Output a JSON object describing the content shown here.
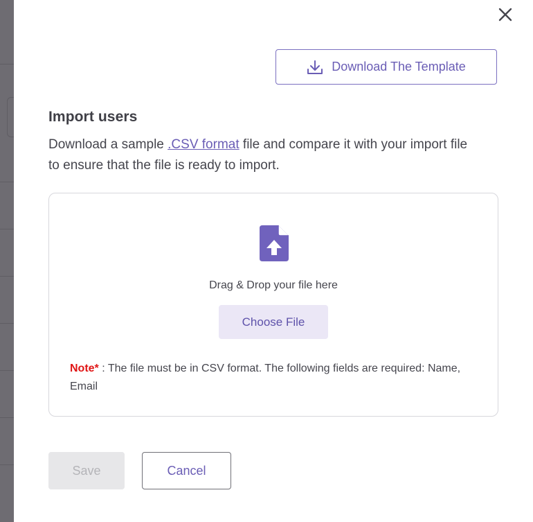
{
  "modal": {
    "close_icon": "close-icon",
    "download_template": {
      "label": "Download The Template",
      "icon": "download-icon"
    },
    "title": "Import users",
    "description": {
      "before_link": "Download a sample ",
      "link_text": ".CSV format",
      "after_link": " file and compare it with your import file to ensure that the file is ready to import."
    },
    "dropzone": {
      "icon": "file-upload-icon",
      "drag_text": "Drag & Drop your file here",
      "choose_label": "Choose File",
      "note_label": "Note*",
      "note_text": " : The file must be in CSV format. The following fields are required: Name, Email"
    },
    "actions": {
      "save_label": "Save",
      "cancel_label": "Cancel"
    }
  },
  "colors": {
    "accent": "#6a5db5",
    "note_red": "#e01515",
    "choose_bg": "#ebe7f6",
    "disabled_bg": "#e7e7e9",
    "backdrop": "#6e6c72"
  }
}
